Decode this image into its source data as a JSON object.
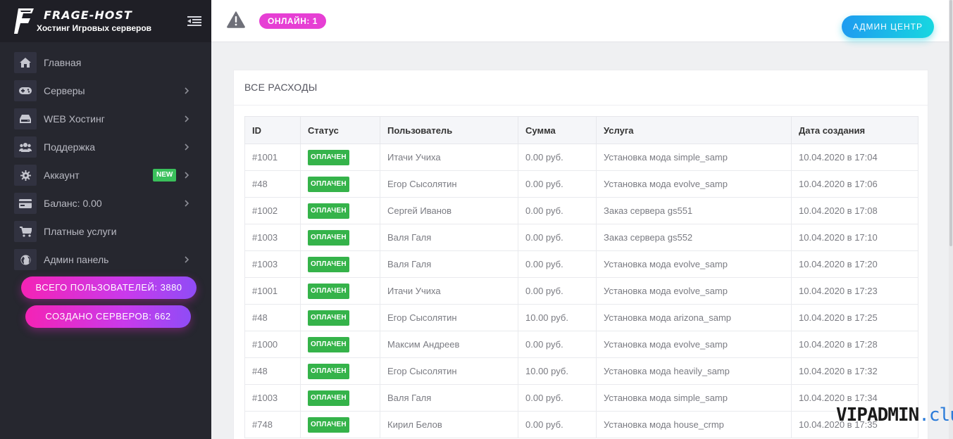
{
  "brand": {
    "name": "FRAGE-HOST",
    "subtitle": "Хостинг Игровых серверов"
  },
  "sidebar": {
    "items": [
      {
        "label": "Главная",
        "icon": "home-icon",
        "chevron": false
      },
      {
        "label": "Серверы",
        "icon": "gamepad-icon",
        "chevron": true
      },
      {
        "label": "WEB Хостинг",
        "icon": "hdd-icon",
        "chevron": true
      },
      {
        "label": "Поддержка",
        "icon": "users-icon",
        "chevron": true
      },
      {
        "label": "Аккаунт",
        "icon": "gear-icon",
        "chevron": true,
        "badge": "NEW"
      },
      {
        "label": "Баланс: 0.00",
        "icon": "credit-card-icon",
        "chevron": true
      },
      {
        "label": "Платные услуги",
        "icon": "cart-icon",
        "chevron": false
      },
      {
        "label": "Админ панель",
        "icon": "globe-icon",
        "chevron": true
      }
    ],
    "total_users": "ВСЕГО ПОЛЬЗОВАТЕЛЕЙ: 3880",
    "servers_created": "СОЗДАНО СЕРВЕРОВ: 662"
  },
  "header": {
    "online": "ОНЛАЙН: 1",
    "admin_button": "АДМИН ЦЕНТР"
  },
  "main": {
    "title": "ВСЕ РАСХОДЫ",
    "columns": [
      "ID",
      "Статус",
      "Пользователь",
      "Сумма",
      "Услуга",
      "Дата создания"
    ],
    "rows": [
      {
        "id": "#1001",
        "status": "ОПЛАЧЕН",
        "user": "Итачи Учиха",
        "amount": "0.00 руб.",
        "service": "Установка мода simple_samp",
        "date": "10.04.2020 в 17:04"
      },
      {
        "id": "#48",
        "status": "ОПЛАЧЕН",
        "user": "Егор Сысолятин",
        "amount": "0.00 руб.",
        "service": "Установка мода evolve_samp",
        "date": "10.04.2020 в 17:06"
      },
      {
        "id": "#1002",
        "status": "ОПЛАЧЕН",
        "user": "Сергей Иванов",
        "amount": "0.00 руб.",
        "service": "Заказ сервера gs551",
        "date": "10.04.2020 в 17:08"
      },
      {
        "id": "#1003",
        "status": "ОПЛАЧЕН",
        "user": "Валя Галя",
        "amount": "0.00 руб.",
        "service": "Заказ сервера gs552",
        "date": "10.04.2020 в 17:10"
      },
      {
        "id": "#1003",
        "status": "ОПЛАЧЕН",
        "user": "Валя Галя",
        "amount": "0.00 руб.",
        "service": "Установка мода evolve_samp",
        "date": "10.04.2020 в 17:20"
      },
      {
        "id": "#1001",
        "status": "ОПЛАЧЕН",
        "user": "Итачи Учиха",
        "amount": "0.00 руб.",
        "service": "Установка мода evolve_samp",
        "date": "10.04.2020 в 17:23"
      },
      {
        "id": "#48",
        "status": "ОПЛАЧЕН",
        "user": "Егор Сысолятин",
        "amount": "10.00 руб.",
        "service": "Установка мода arizona_samp",
        "date": "10.04.2020 в 17:25"
      },
      {
        "id": "#1000",
        "status": "ОПЛАЧЕН",
        "user": "Максим Андреев",
        "amount": "0.00 руб.",
        "service": "Установка мода evolve_samp",
        "date": "10.04.2020 в 17:28"
      },
      {
        "id": "#48",
        "status": "ОПЛАЧЕН",
        "user": "Егор Сысолятин",
        "amount": "10.00 руб.",
        "service": "Установка мода heavily_samp",
        "date": "10.04.2020 в 17:32"
      },
      {
        "id": "#1003",
        "status": "ОПЛАЧЕН",
        "user": "Валя Галя",
        "amount": "0.00 руб.",
        "service": "Установка мода simple_samp",
        "date": "10.04.2020 в 17:34"
      },
      {
        "id": "#748",
        "status": "ОПЛАЧЕН",
        "user": "Кирил Белов",
        "amount": "0.00 руб.",
        "service": "Установка мода house_crmp",
        "date": "10.04.2020 в 17:35"
      }
    ]
  },
  "watermark": {
    "main": "VIPADMIN",
    "suffix": ".club"
  },
  "colors": {
    "sidebar_bg": "#26272f",
    "accent_pink": "#e63fd4",
    "accent_cyan": "#17d7e0",
    "status_green": "#35b34a"
  }
}
